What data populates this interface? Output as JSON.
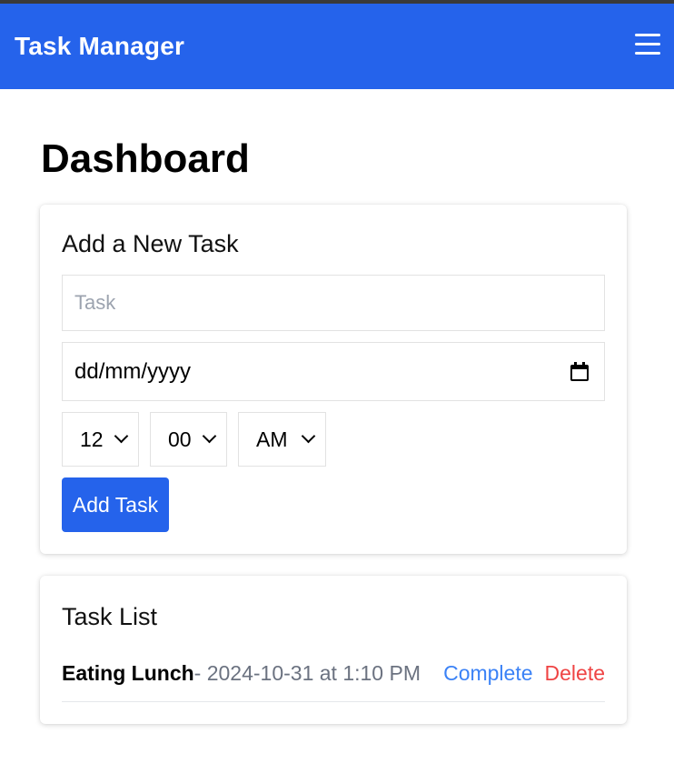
{
  "app": {
    "title": "Task Manager",
    "menu_icon": "hamburger-menu-icon"
  },
  "page": {
    "title": "Dashboard"
  },
  "add_task": {
    "heading": "Add a New Task",
    "task_placeholder": "Task",
    "task_value": "",
    "date_value": "dd/mm/yyyy",
    "date_icon": "calendar-icon",
    "hour": "12",
    "minute": "00",
    "ampm": "AM",
    "submit_label": "Add Task"
  },
  "task_list": {
    "heading": "Task List",
    "items": [
      {
        "name": "Eating Lunch",
        "meta": "- 2024-10-31 at 1:10 PM",
        "complete_label": "Complete",
        "delete_label": "Delete"
      }
    ]
  },
  "colors": {
    "primary": "#2563eb",
    "complete": "#3b82f6",
    "delete": "#ef4444",
    "muted_text": "#6b7280"
  }
}
